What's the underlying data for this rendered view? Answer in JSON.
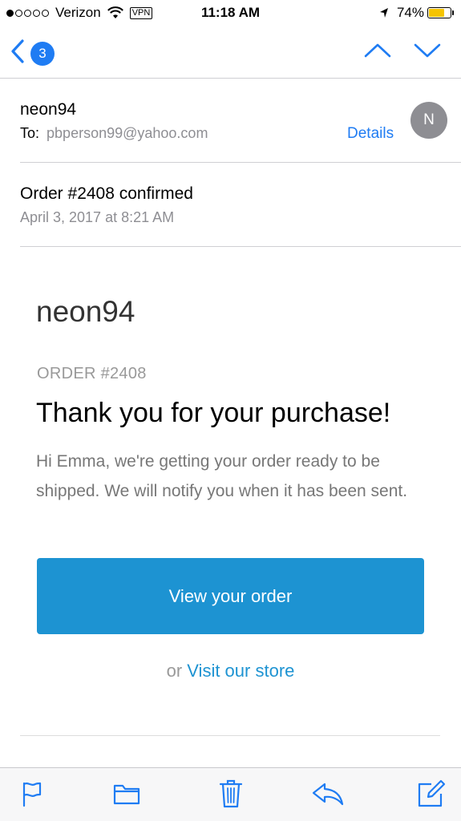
{
  "status_bar": {
    "carrier": "Verizon",
    "vpn": "VPN",
    "time": "11:18 AM",
    "battery_percent": "74%",
    "battery_level": 0.74,
    "battery_color": "#f5c400"
  },
  "nav": {
    "back_icon": "chevron-left-icon",
    "unread_count": "3",
    "prev_icon": "chevron-up-icon",
    "next_icon": "chevron-down-icon"
  },
  "header": {
    "sender": "neon94",
    "to_label": "To:",
    "to_address": "pbperson99@yahoo.com",
    "details_label": "Details",
    "avatar_initial": "N",
    "subject": "Order #2408 confirmed",
    "date": "April 3, 2017 at 8:21 AM"
  },
  "body": {
    "shop_name": "neon94",
    "order_label": "ORDER #2408",
    "heading": "Thank you for your purchase!",
    "message": "Hi Emma, we're getting your order ready to be shipped. We will notify you when it has been sent.",
    "cta_label": "View your order",
    "alt_prefix": "or",
    "alt_link": "Visit our store"
  },
  "colors": {
    "ios_blue": "#1f7cf3",
    "cta_blue": "#1d93d2"
  },
  "toolbar": {
    "icons": [
      "flag-icon",
      "folder-icon",
      "trash-icon",
      "reply-icon",
      "compose-icon"
    ]
  }
}
